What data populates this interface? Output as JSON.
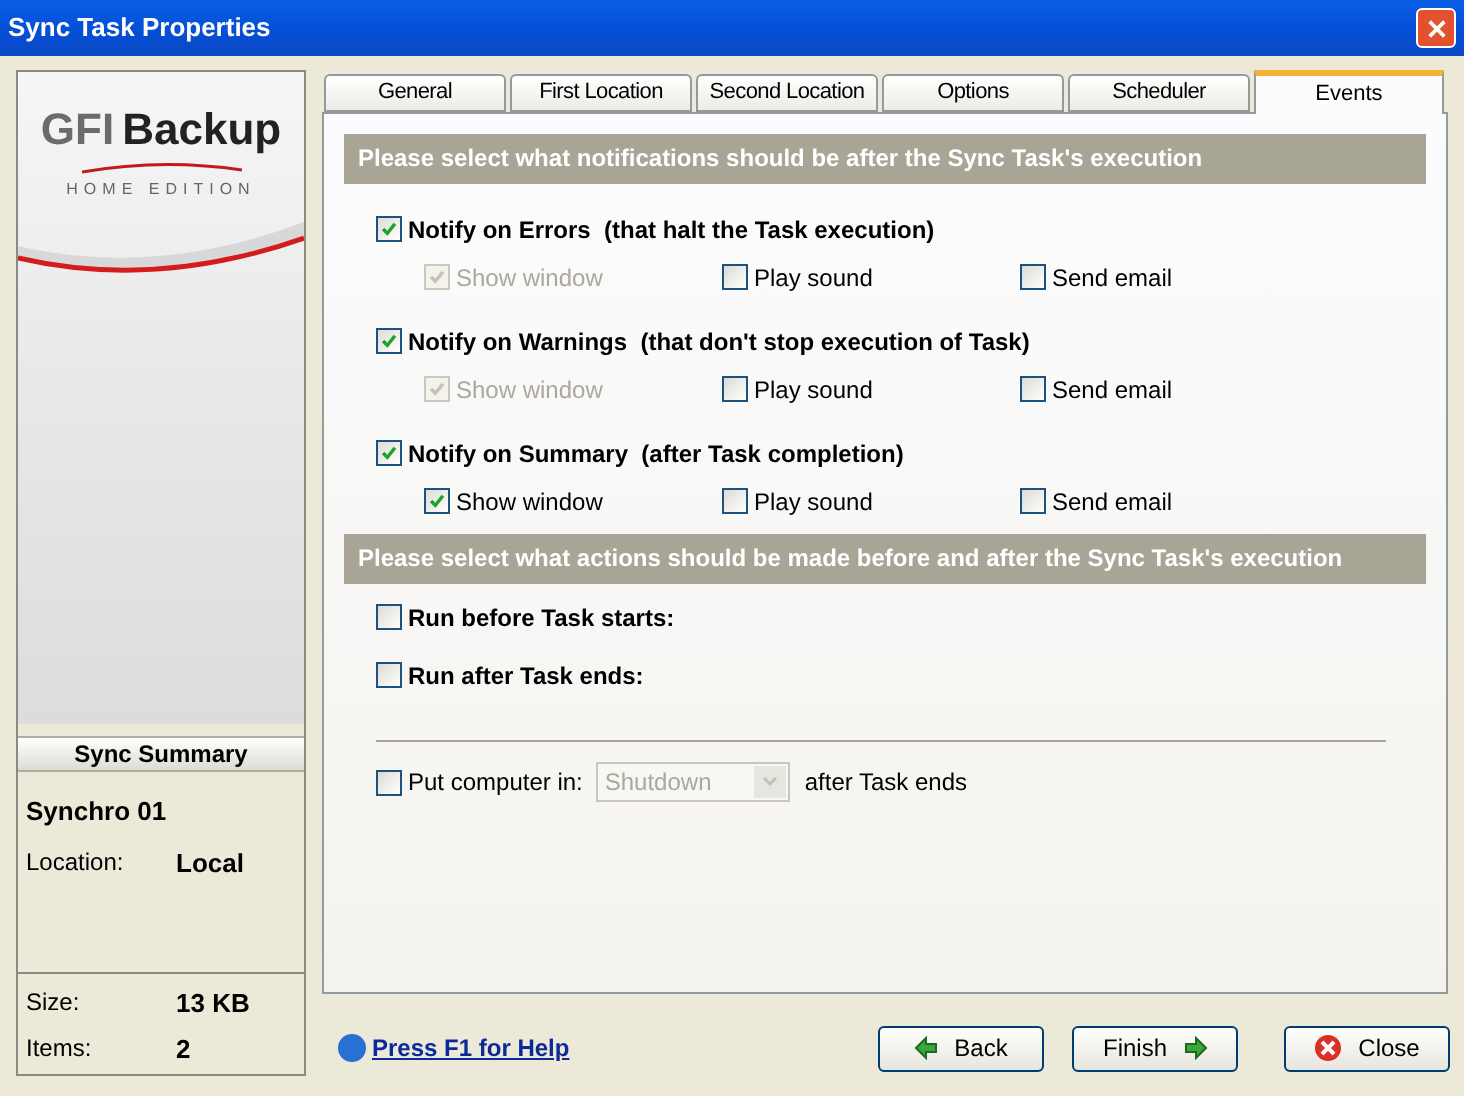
{
  "window": {
    "title": "Sync Task Properties"
  },
  "sidebar": {
    "logo": {
      "brand_prefix": "GFI",
      "brand": "Backup",
      "edition": "HOME EDITION"
    },
    "summary_title": "Sync Summary",
    "task_name": "Synchro 01",
    "details": [
      {
        "label": "Location:",
        "value": "Local"
      }
    ],
    "totals": [
      {
        "label": "Size:",
        "value": "13 KB"
      },
      {
        "label": "Items:",
        "value": "2"
      }
    ]
  },
  "tabs": [
    {
      "label": "General",
      "selected": false
    },
    {
      "label": "First Location",
      "selected": false
    },
    {
      "label": "Second Location",
      "selected": false
    },
    {
      "label": "Options",
      "selected": false
    },
    {
      "label": "Scheduler",
      "selected": false
    },
    {
      "label": "Events",
      "selected": true
    }
  ],
  "notifications": {
    "heading": "Please select what notifications should be after the Sync Task's execution",
    "groups": [
      {
        "label": "Notify on Errors  (that halt the Task execution)",
        "checked": true,
        "options": [
          {
            "label": "Show window",
            "checked": true,
            "disabled": true
          },
          {
            "label": "Play sound",
            "checked": false,
            "disabled": false
          },
          {
            "label": "Send email",
            "checked": false,
            "disabled": false
          }
        ]
      },
      {
        "label": "Notify on Warnings  (that don't stop execution of Task)",
        "checked": true,
        "options": [
          {
            "label": "Show window",
            "checked": true,
            "disabled": true
          },
          {
            "label": "Play sound",
            "checked": false,
            "disabled": false
          },
          {
            "label": "Send email",
            "checked": false,
            "disabled": false
          }
        ]
      },
      {
        "label": "Notify on Summary  (after Task completion)",
        "checked": true,
        "options": [
          {
            "label": "Show window",
            "checked": true,
            "disabled": false
          },
          {
            "label": "Play sound",
            "checked": false,
            "disabled": false
          },
          {
            "label": "Send email",
            "checked": false,
            "disabled": false
          }
        ]
      }
    ]
  },
  "actions": {
    "heading": "Please select what actions should be made before and after the Sync Task's execution",
    "items": [
      {
        "label": "Run before Task starts:",
        "checked": false
      },
      {
        "label": "Run after Task ends:",
        "checked": false
      }
    ],
    "power": {
      "label": "Put computer in:",
      "checked": false,
      "value": "Shutdown",
      "disabled": true,
      "suffix": "after Task ends"
    }
  },
  "help_link": "Press F1 for Help",
  "buttons": [
    {
      "label": "Back",
      "kind": "back"
    },
    {
      "label": "Finish",
      "kind": "finish"
    },
    {
      "label": "Close",
      "kind": "close"
    }
  ]
}
